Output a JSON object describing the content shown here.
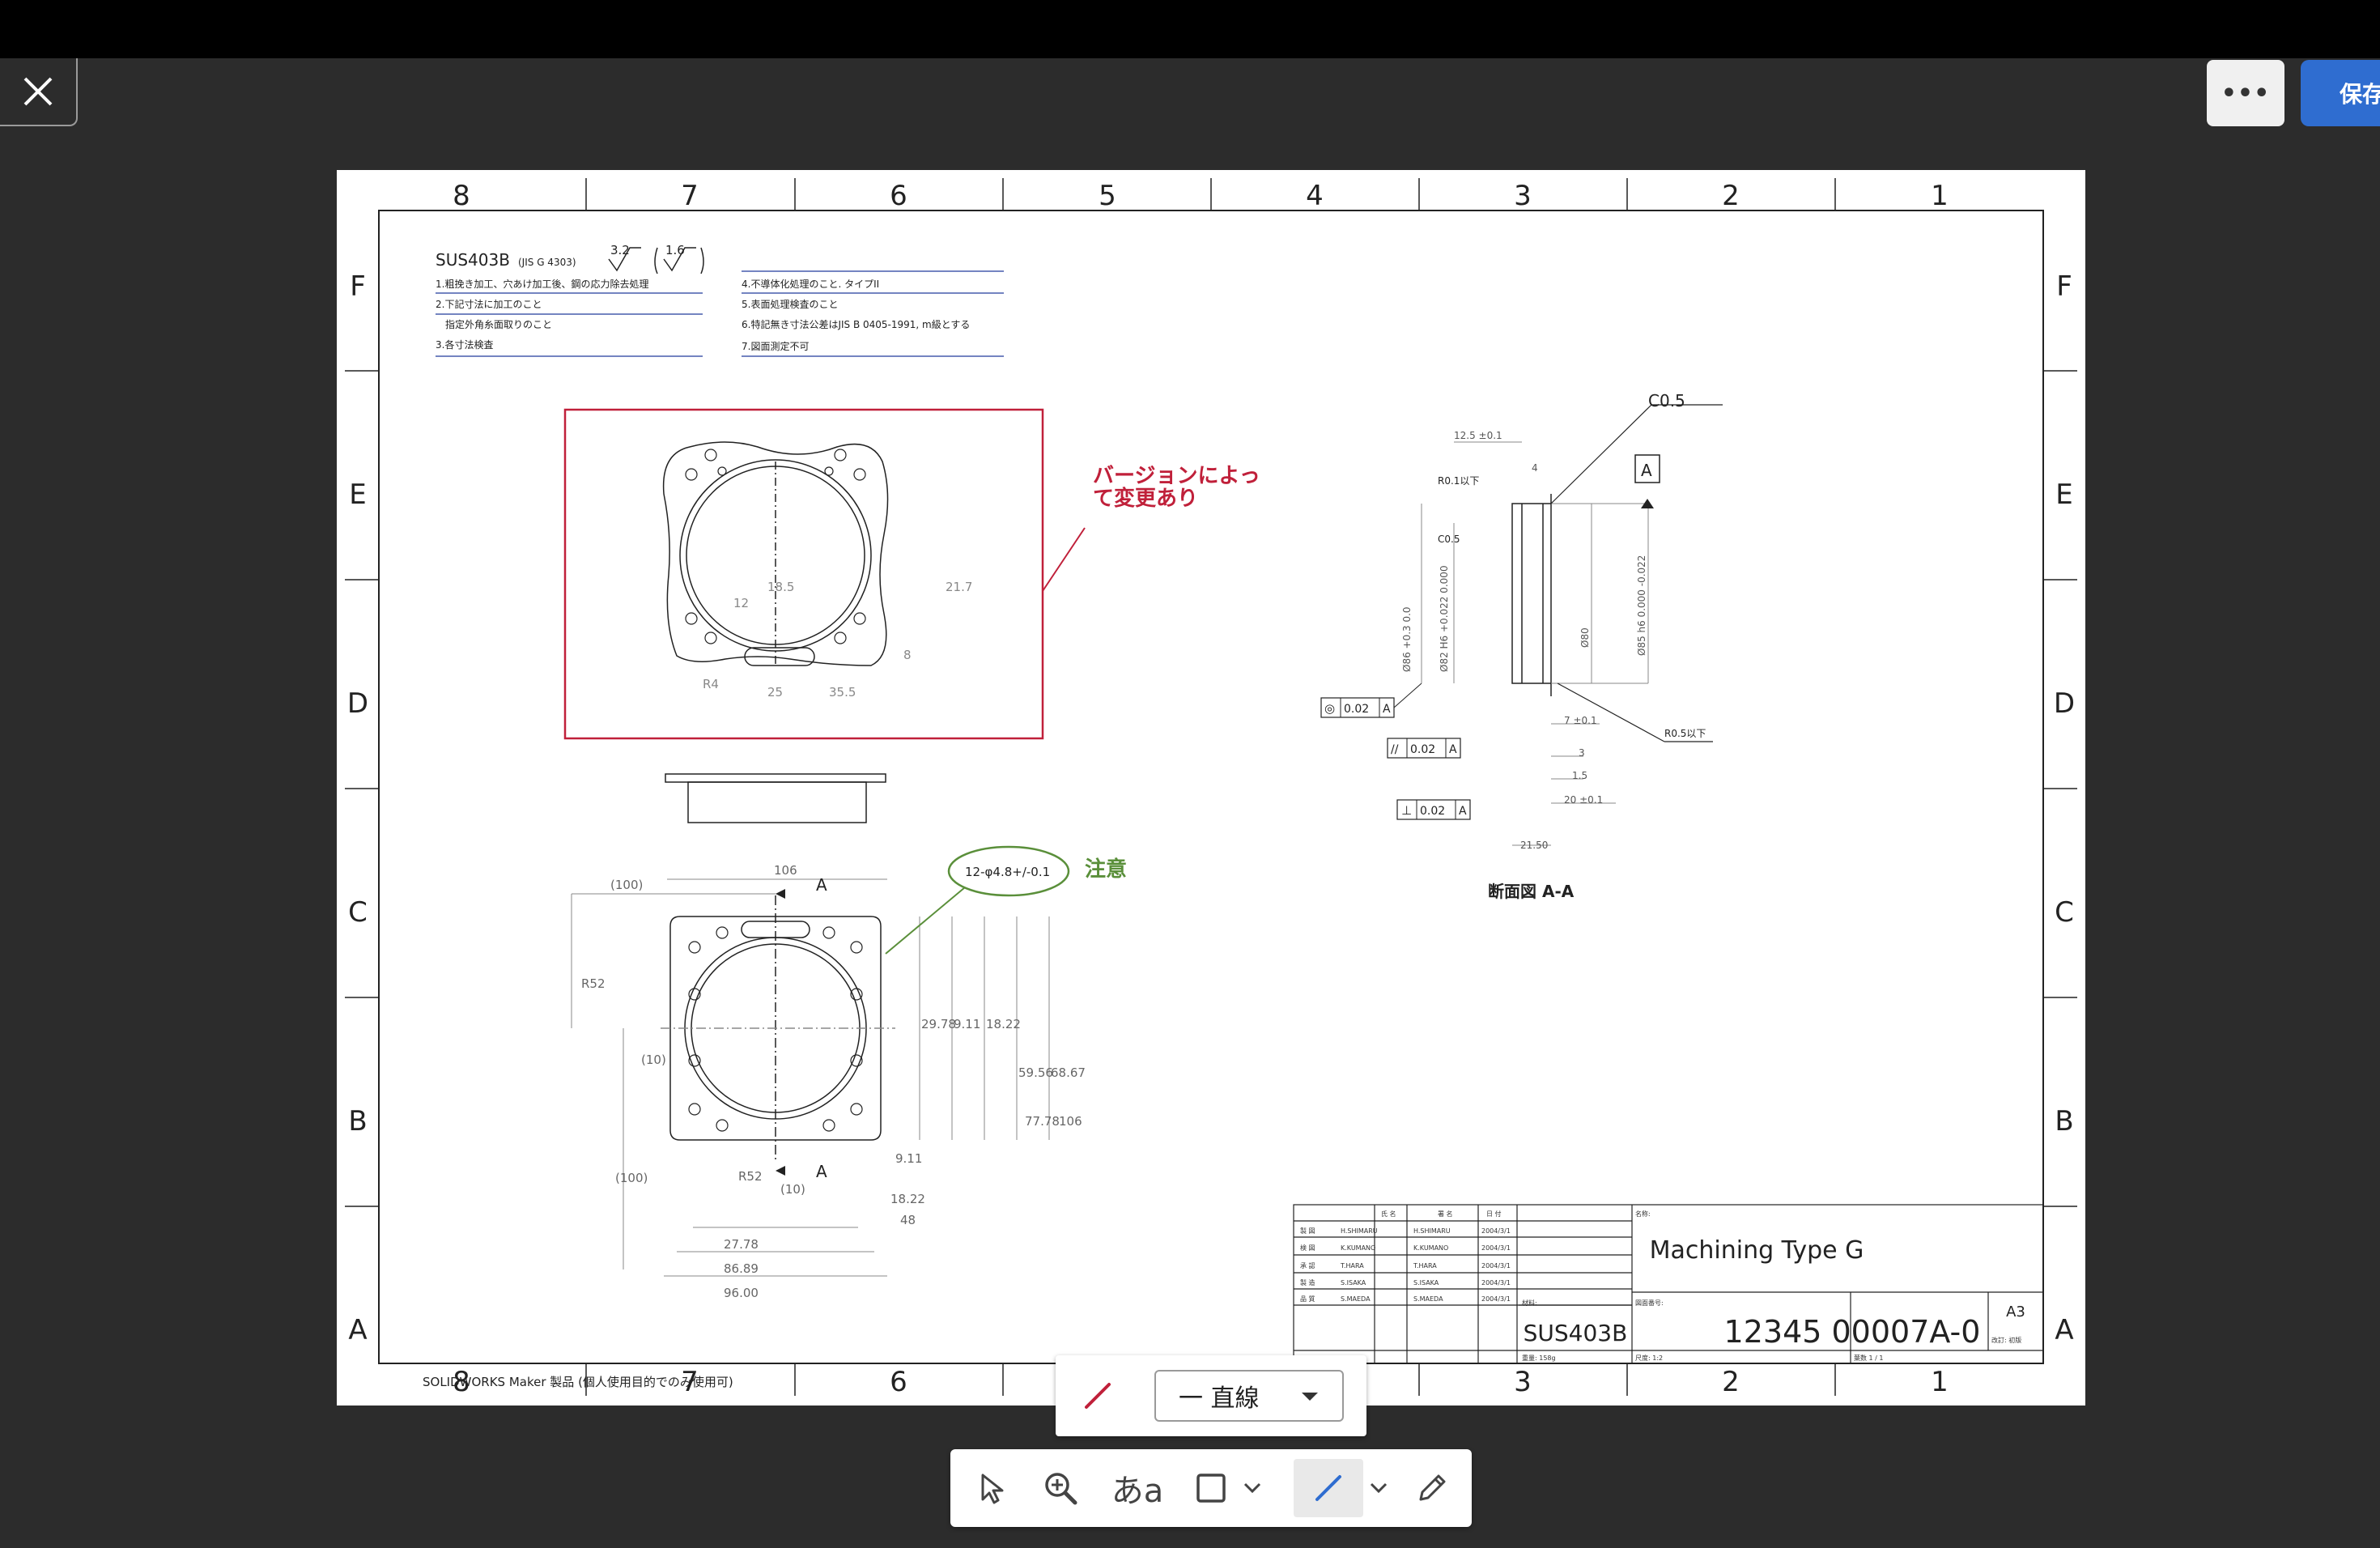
{
  "window": {
    "close_icon": "close-icon",
    "more_icon": "more-horizontal-icon",
    "more_label": "•••",
    "save_label": "保存"
  },
  "drawing": {
    "frame_columns_top": [
      "8",
      "7",
      "6",
      "5",
      "4",
      "3",
      "2",
      "1"
    ],
    "frame_columns_bottom": [
      "8",
      "7",
      "6",
      "",
      "",
      "3",
      "2",
      "1"
    ],
    "frame_rows": [
      "F",
      "E",
      "D",
      "C",
      "B",
      "A"
    ],
    "material_header": "SUS403B",
    "material_standard": "(JIS G 4303)",
    "roughness_1": "3.2",
    "roughness_2": "1.6",
    "notes_left": [
      "1.粗挽き加工、穴あけ加工後、鋼の応力除去処理",
      "2.下記寸法に加工のこと",
      "指定外角糸面取りのこと",
      "3.各寸法検査"
    ],
    "notes_right": [
      "4.不導体化処理のこと. タイプII",
      "5.表面処理検査のこと",
      "6.特記無き寸法公差はJIS B 0405-1991, m級とする",
      "7.図面測定不可"
    ],
    "annotation_version": [
      "バージョンによっ",
      "て変更あり"
    ],
    "annotation_note_bubble": "12-φ4.8+/-0.1",
    "annotation_caution": "注意",
    "section_label": "断面図 A-A",
    "dims_top_view": [
      "18.5",
      "12",
      "21.7",
      "8",
      "R4",
      "25",
      "35.5"
    ],
    "dims_plan_view": [
      "106",
      "(100)",
      "A",
      "R52",
      "(10)",
      "(100)",
      "R52",
      "(10)",
      "A",
      "29.78",
      "9.11",
      "18.22",
      "59.56",
      "68.67",
      "77.78",
      "106",
      "9.11",
      "18.22",
      "48",
      "27.78",
      "86.89",
      "96.00"
    ],
    "dims_section": [
      "C0.5",
      "12.5 ±0.1",
      "4",
      "A",
      "R0.1以下",
      "C0.5",
      "Ø86 +0.3 0.0",
      "Ø82 H6 +0.022 0.000",
      "Ø80",
      "Ø85 h6 0.000 -0.022",
      "R0.5以下",
      "7 ±0.1",
      "3",
      "1.5",
      "20 ±0.1",
      "21.50"
    ],
    "gdt_concentricity": [
      "◎",
      "0.02",
      "A"
    ],
    "gdt_parallel": [
      "//",
      "0.02",
      "A"
    ],
    "gdt_perpendicular": [
      "⊥",
      "0.02",
      "A"
    ],
    "titleblock": {
      "col_headers": [
        "氏 名",
        "署 名",
        "日 付"
      ],
      "rows": [
        [
          "製 図",
          "H.SHIMARU",
          "H.SHIMARU",
          "2004/3/1"
        ],
        [
          "検 図",
          "K.KUMANO",
          "K.KUMANO",
          "2004/3/1"
        ],
        [
          "承 認",
          "T.HARA",
          "T.HARA",
          "2004/3/1"
        ],
        [
          "製 造",
          "S.ISAKA",
          "S.ISAKA",
          "2004/3/1"
        ],
        [
          "品 質",
          "S.MAEDA",
          "S.MAEDA",
          "2004/3/1"
        ]
      ],
      "name_label": "名称:",
      "name_value": "Machining Type G",
      "material_label": "材料:",
      "material_value": "SUS403B",
      "drawing_no_label": "図面番号:",
      "drawing_no_value": "12345 00007A-0",
      "size_value": "A3",
      "revision_label": "改訂: 初版",
      "weight_label": "重量: 158g",
      "scale_label": "尺度: 1:2",
      "sheet_label": "葉数 1 / 1"
    },
    "footer_note": "SOLIDWORKS Maker 製品 (個人使用目的でのみ使用可)"
  },
  "line_style_popover": {
    "pen_color": "#c0203a",
    "line_style_label": "一 直線"
  },
  "toolbar": {
    "tools": [
      "select-arrow-icon",
      "zoom-in-icon",
      "text-tool-icon",
      "rectangle-icon",
      "line-tool-icon",
      "pencil-icon"
    ],
    "text_tool_label": "あa"
  },
  "colors": {
    "accent_red": "#c0203a",
    "accent_green": "#5a8f3a",
    "accent_blue": "#2f6dd0"
  }
}
